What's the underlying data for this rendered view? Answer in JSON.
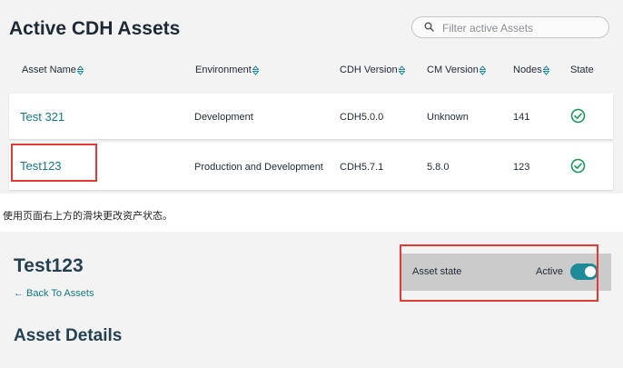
{
  "asset_list": {
    "title": "Active CDH Assets",
    "filter_placeholder": "Filter active Assets",
    "columns": [
      "Asset Name",
      "Environment",
      "CDH Version",
      "CM Version",
      "Nodes",
      "State"
    ],
    "rows": [
      {
        "name": "Test 321",
        "environment": "Development",
        "cdh_version": "CDH5.0.0",
        "cm_version": "Unknown",
        "nodes": "141",
        "state": "check-circle-icon"
      },
      {
        "name": "Test123",
        "environment": "Production and Development",
        "cdh_version": "CDH5.7.1",
        "cm_version": "5.8.0",
        "nodes": "123",
        "state": "check-circle-icon"
      }
    ]
  },
  "caption": "使用页面右上方的滑块更改资产状态。",
  "asset_detail": {
    "title": "Test123",
    "back_link": "← Back To Assets",
    "section_title": "Asset Details",
    "state_label": "Asset state",
    "state_value": "Active",
    "toggle_on": true
  },
  "colors": {
    "link": "#127a86",
    "toggle": "#1f8a99",
    "check": "#1a9a58",
    "highlight": "#e53a2f",
    "panel_bg": "#f3f3f3"
  }
}
